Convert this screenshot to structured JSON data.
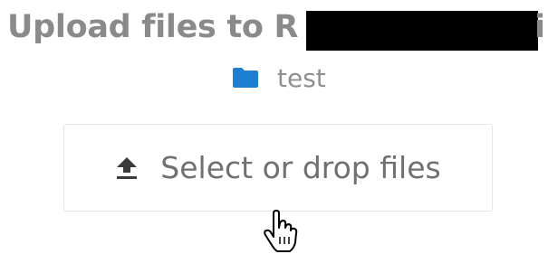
{
  "header": {
    "title": "Upload files to R",
    "title_tail": "i",
    "redaction": "redacted-block"
  },
  "target": {
    "folder_icon": "folder-icon",
    "folder_name": "test",
    "folder_color": "#1c7fd1"
  },
  "drop_zone": {
    "icon": "upload-icon",
    "label": "Select or drop files"
  },
  "cursor": {
    "icon": "hand-pointer-icon"
  }
}
